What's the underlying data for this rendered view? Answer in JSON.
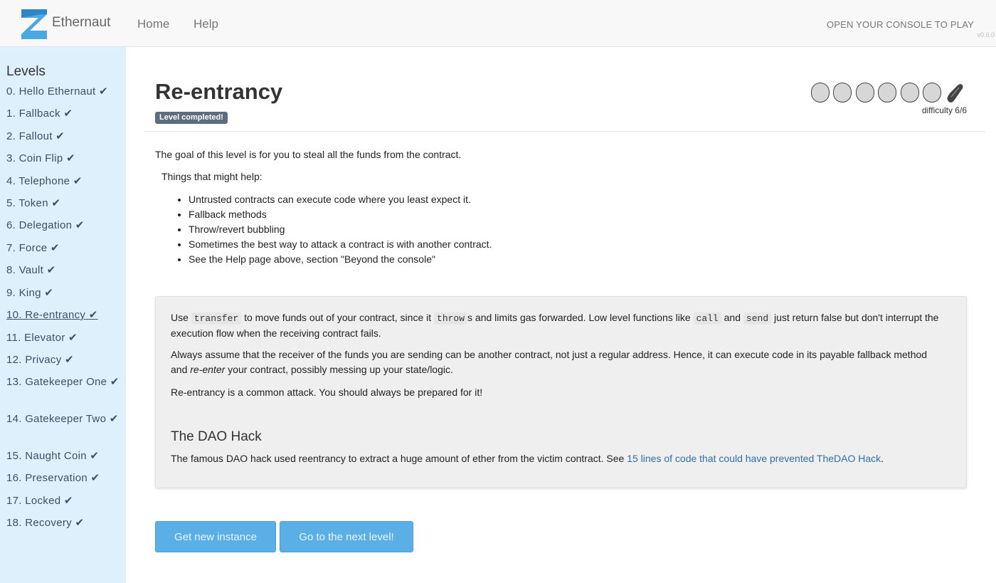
{
  "header": {
    "brand": "Ethernaut",
    "nav": [
      "Home",
      "Help"
    ],
    "right_text": "OPEN YOUR CONSOLE TO PLAY",
    "version": "v0.6.0"
  },
  "sidebar": {
    "title": "Levels",
    "check": "✔",
    "levels": [
      {
        "label": "0. Hello Ethernaut"
      },
      {
        "label": "1. Fallback"
      },
      {
        "label": "2. Fallout"
      },
      {
        "label": "3. Coin Flip"
      },
      {
        "label": "4. Telephone"
      },
      {
        "label": "5. Token"
      },
      {
        "label": "6. Delegation"
      },
      {
        "label": "7. Force"
      },
      {
        "label": "8. Vault"
      },
      {
        "label": "9. King"
      },
      {
        "label": "10. Re-entrancy"
      },
      {
        "label": "11. Elevator"
      },
      {
        "label": "12. Privacy"
      },
      {
        "label": "13. Gatekeeper One"
      },
      {
        "label": "14. Gatekeeper Two"
      },
      {
        "label": "15. Naught Coin"
      },
      {
        "label": "16. Preservation"
      },
      {
        "label": "17. Locked"
      },
      {
        "label": "18. Recovery"
      }
    ],
    "active_index": 10
  },
  "main": {
    "title": "Re-entrancy",
    "badge": "Level completed!",
    "difficulty": "difficulty 6/6",
    "difficulty_icons": [
      "character-icon-1",
      "character-icon-2",
      "character-icon-3",
      "character-icon-4",
      "character-icon-5",
      "character-icon-6",
      "pickle-icon"
    ],
    "goal": "The goal of this level is for you to steal all the funds from the contract.",
    "help_title": "Things that might help:",
    "hints": [
      "Untrusted contracts can execute code where you least expect it.",
      "Fallback methods",
      "Throw/revert bubbling",
      "Sometimes the best way to attack a contract is with another contract.",
      "See the Help page above, section \"Beyond the console\""
    ]
  },
  "info": {
    "p1": {
      "t1": "Use ",
      "c1": "transfer",
      "t2": " to move funds out of your contract, since it ",
      "c2": "throw",
      "t3": "s and limits gas forwarded. Low level functions like ",
      "c3": "call",
      "t4": " and ",
      "c4": "send",
      "t5": " just return false but don't interrupt the execution flow when the receiving contract fails."
    },
    "p2": {
      "t1": "Always assume that the receiver of the funds you are sending can be another contract, not just a regular address. Hence, it can execute code in its payable fallback method and ",
      "em": "re-enter",
      "t2": " your contract, possibly messing up your state/logic."
    },
    "p3": "Re-entrancy is a common attack. You should always be prepared for it!",
    "dao_title": "The DAO Hack",
    "dao": {
      "t1": "The famous DAO hack used reentrancy to extract a huge amount of ether from the victim contract. See ",
      "link": "15 lines of code that could have prevented TheDAO Hack",
      "t2": "."
    }
  },
  "buttons": {
    "new_instance": "Get new instance",
    "next_level": "Go to the next level!"
  },
  "colors": {
    "sidebar_bg": "#dff0fd",
    "button_bg": "#5aafe6",
    "badge_bg": "#5d6d7e",
    "link": "#2f6fa7"
  }
}
